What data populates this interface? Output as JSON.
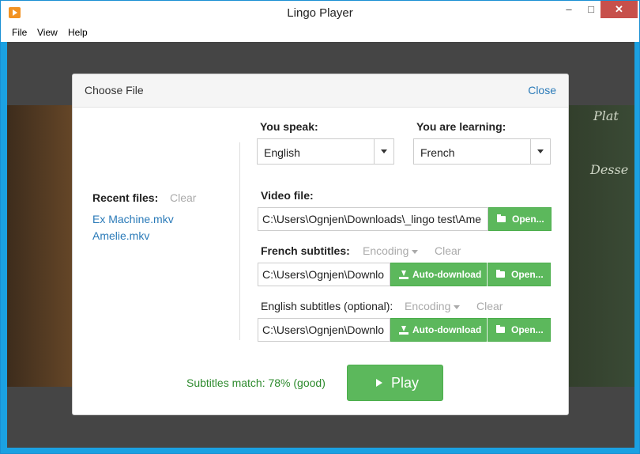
{
  "window": {
    "title": "Lingo Player",
    "minimize": "–",
    "maximize": "□",
    "close": "✕"
  },
  "menu": [
    "File",
    "View",
    "Help"
  ],
  "dialog": {
    "title": "Choose File",
    "close": "Close",
    "you_speak": {
      "label": "You speak:",
      "value": "English"
    },
    "you_learn": {
      "label": "You are learning:",
      "value": "French"
    },
    "recent": {
      "label": "Recent files:",
      "clear": "Clear",
      "files": [
        "Ex Machine.mkv",
        "Amelie.mkv"
      ]
    },
    "video": {
      "label": "Video file:",
      "path": "C:\\Users\\Ognjen\\Downloads\\_lingo test\\Ame",
      "open": "Open..."
    },
    "french_subs": {
      "label": "French subtitles:",
      "encoding": "Encoding",
      "clear": "Clear",
      "path": "C:\\Users\\Ognjen\\Downlo",
      "auto": "Auto-download",
      "open": "Open..."
    },
    "english_subs": {
      "label": "English subtitles (optional):",
      "encoding": "Encoding",
      "clear": "Clear",
      "path": "C:\\Users\\Ognjen\\Downlo",
      "auto": "Auto-download",
      "open": "Open..."
    },
    "match": "Subtitles match: 78% (good)",
    "play": "Play"
  },
  "colors": {
    "accent": "#5cb85c",
    "link": "#2a7ab8",
    "match": "#2e8b2e",
    "titlebar_close": "#c7504b"
  },
  "icons": [
    "app-icon",
    "folder-open-icon",
    "download-icon",
    "play-icon",
    "caret-down-icon"
  ]
}
